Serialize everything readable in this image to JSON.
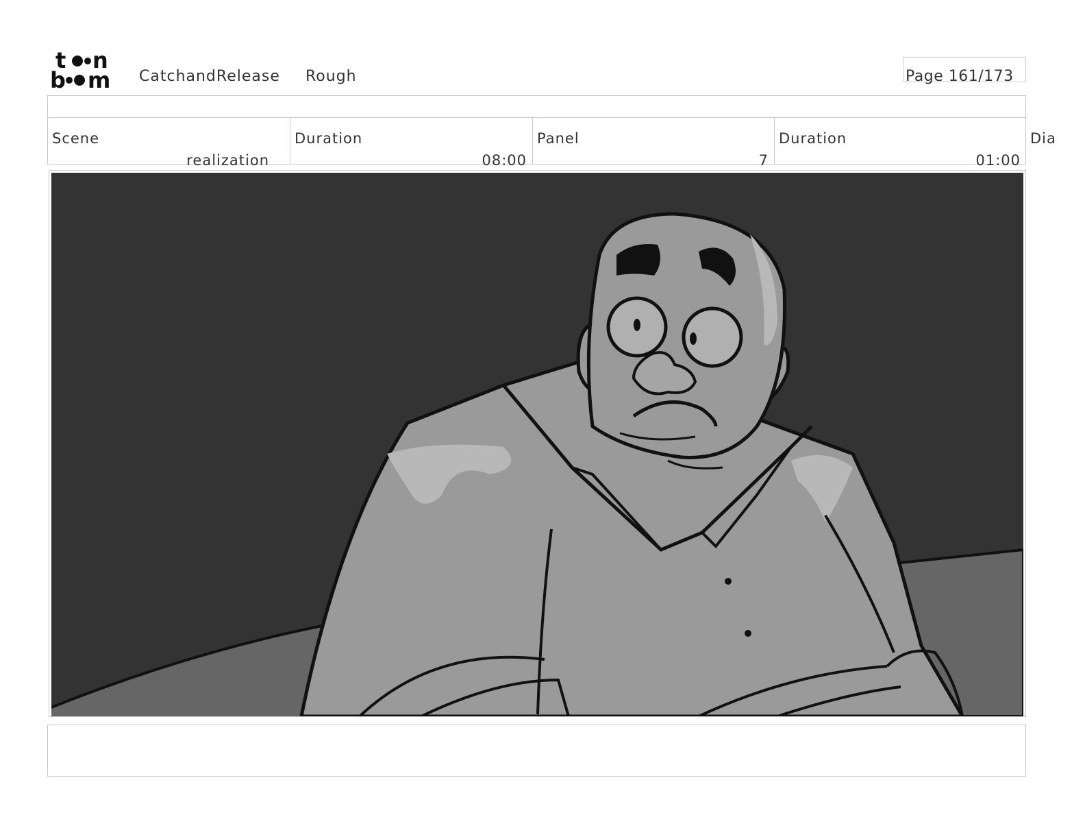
{
  "header": {
    "logo_text": "toon boom",
    "project": "CatchandRelease",
    "stage": "Rough",
    "page": "Page 161/173"
  },
  "fields": [
    {
      "label": "Scene",
      "value": "realization"
    },
    {
      "label": "Duration",
      "value": "08:00"
    },
    {
      "label": "Panel",
      "value": "7"
    },
    {
      "label": "Duration",
      "value": "01:00"
    }
  ],
  "dialog_label": "Dia",
  "colors": {
    "background_wall": "#333333",
    "floor": "#666666",
    "skin": "#999999",
    "shirt": "#9a9a9a",
    "highlight": "#b8b8b8",
    "line": "#111111"
  }
}
